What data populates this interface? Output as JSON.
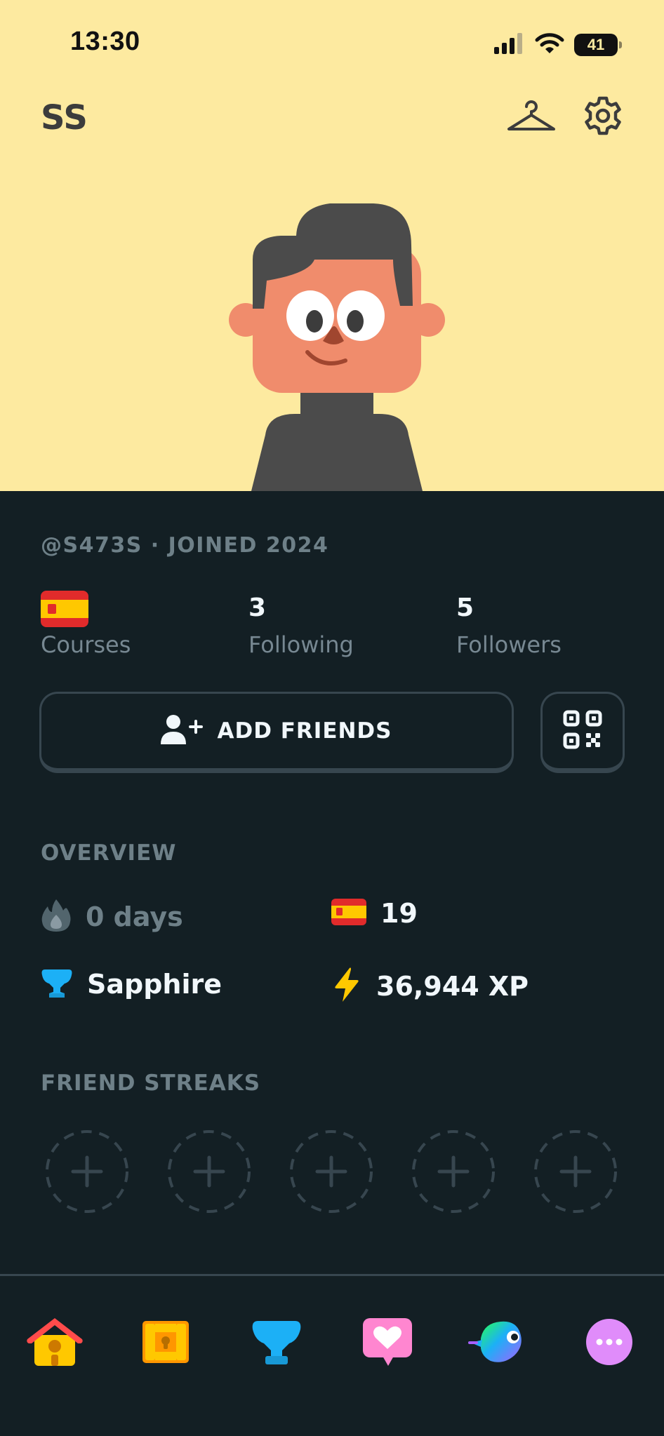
{
  "status_bar": {
    "time": "13:30",
    "battery": "41"
  },
  "profile": {
    "name": "SS",
    "meta": "@S473S · JOINED 2024"
  },
  "stats": {
    "courses": {
      "label": "Courses"
    },
    "following": {
      "value": "3",
      "label": "Following"
    },
    "followers": {
      "value": "5",
      "label": "Followers"
    }
  },
  "add_friends_label": "ADD FRIENDS",
  "overview": {
    "title": "OVERVIEW",
    "streak": "0 days",
    "course_crowns": "19",
    "league": "Sapphire",
    "xp": "36,944 XP"
  },
  "friend_streaks": {
    "title": "FRIEND STREAKS",
    "slots": 5
  },
  "nav": [
    "home-icon",
    "treasure-chest-icon",
    "league-trophy-icon",
    "heart-speech-bubble-icon",
    "duo-bird-icon",
    "more-dots-icon"
  ],
  "colors": {
    "hero": "#fdeaa0",
    "background": "#131f24",
    "border": "#37464f",
    "text": "#f1f7fb",
    "muted": "#6e8088",
    "sapphire": "#1cb0f6",
    "xp": "#ffc800",
    "more": "#e08cfa"
  }
}
